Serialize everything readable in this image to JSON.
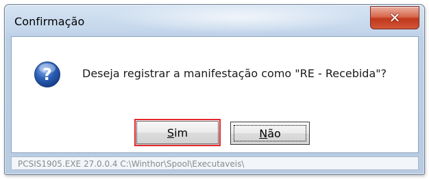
{
  "dialog": {
    "title": "Confirmação",
    "close_glyph": "✕",
    "icon": "question-icon",
    "message": "Deseja registrar a manifestação como \"RE - Recebida\"?",
    "buttons": {
      "yes": {
        "mnemonic": "S",
        "rest": "im"
      },
      "no": {
        "mnemonic": "N",
        "rest": "ão"
      }
    },
    "status_text": "PCSIS1905.EXE 27.0.0.4 C:\\Winthor\\Spool\\Executaveis\\"
  },
  "colors": {
    "highlight_border": "#e2262b",
    "close_button": "#c1381b",
    "icon_blue": "#2b5fb8"
  }
}
